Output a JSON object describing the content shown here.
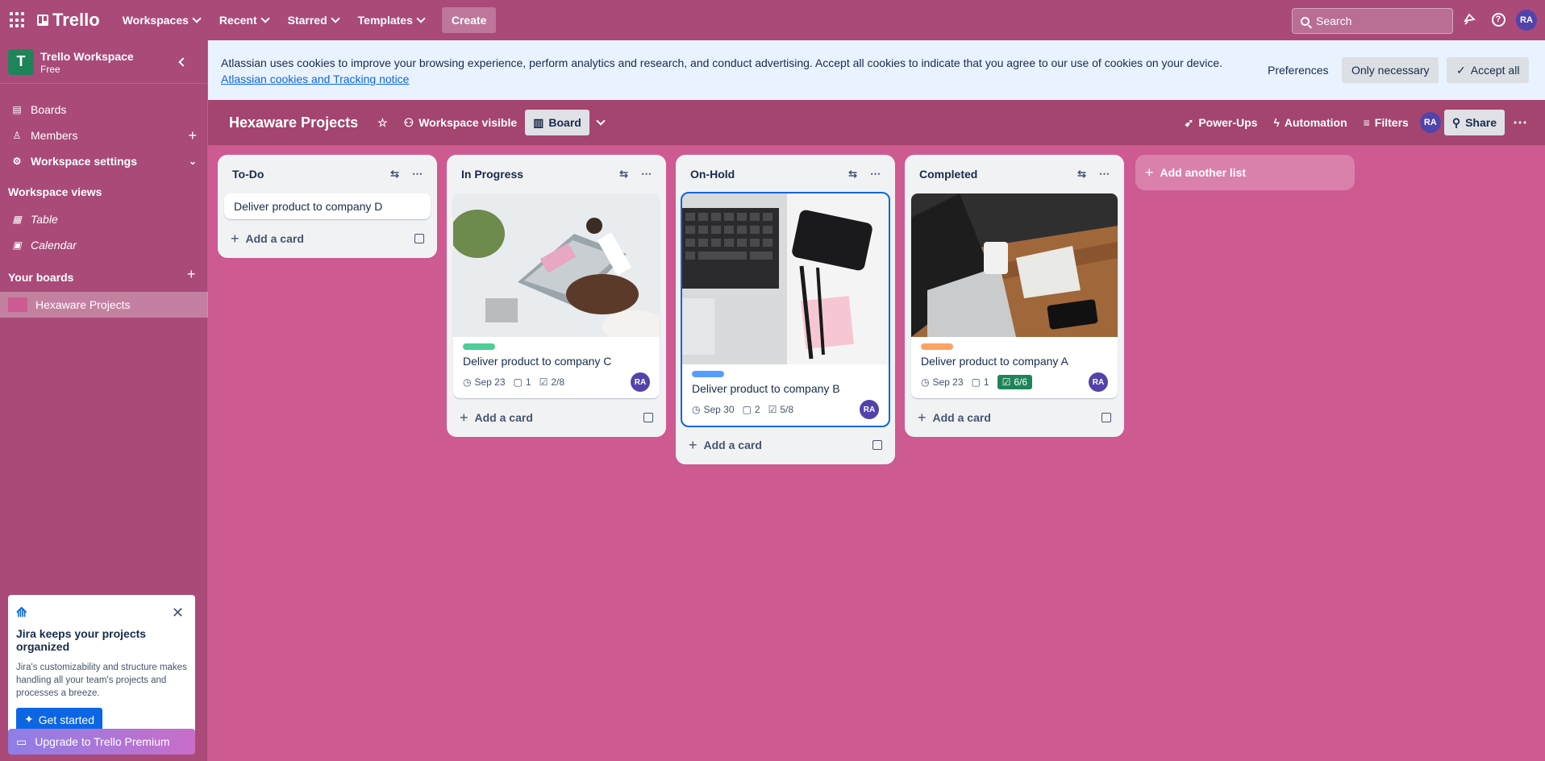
{
  "topnav": {
    "brand": "Trello",
    "menus": [
      "Workspaces",
      "Recent",
      "Starred",
      "Templates"
    ],
    "create_label": "Create",
    "search_placeholder": "Search",
    "user_initials": "RA"
  },
  "sidebar": {
    "workspace_initial": "T",
    "workspace_name": "Trello Workspace",
    "workspace_plan": "Free",
    "items": [
      {
        "label": "Boards"
      },
      {
        "label": "Members"
      },
      {
        "label": "Workspace settings"
      }
    ],
    "views_heading": "Workspace views",
    "views": [
      {
        "label": "Table"
      },
      {
        "label": "Calendar"
      }
    ],
    "boards_heading": "Your boards",
    "boards": [
      {
        "label": "Hexaware Projects"
      }
    ],
    "promo": {
      "title": "Jira keeps your projects organized",
      "body": "Jira's customizability and structure makes handling all your team's projects and processes a breeze.",
      "cta": "Get started"
    },
    "upgrade_label": "Upgrade to Trello Premium"
  },
  "cookie_banner": {
    "message": "Atlassian uses cookies to improve your browsing experience, perform analytics and research, and conduct advertising. Accept all cookies to indicate that you agree to our use of cookies on your device.",
    "link": "Atlassian cookies and Tracking notice",
    "preferences": "Preferences",
    "only_necessary": "Only necessary",
    "accept_all": "Accept all"
  },
  "board_header": {
    "title": "Hexaware Projects",
    "visibility": "Workspace visible",
    "view": "Board",
    "powerups": "Power-Ups",
    "automation": "Automation",
    "filters": "Filters",
    "member_initials": "RA",
    "share": "Share"
  },
  "lists": [
    {
      "title": "To-Do",
      "cards": [
        {
          "title": "Deliver product to company D"
        }
      ],
      "add_card": "Add a card"
    },
    {
      "title": "In Progress",
      "cards": [
        {
          "title": "Deliver product to company C",
          "label_color": "#4bce97",
          "due": "Sep 23",
          "comments": "1",
          "checklist": "2/8",
          "member": "RA"
        }
      ],
      "add_card": "Add a card"
    },
    {
      "title": "On-Hold",
      "cards": [
        {
          "title": "Deliver product to company B",
          "label_color": "#579dff",
          "due": "Sep 30",
          "comments": "2",
          "checklist": "5/8",
          "member": "RA"
        }
      ],
      "add_card": "Add a card"
    },
    {
      "title": "Completed",
      "cards": [
        {
          "title": "Deliver product to company A",
          "label_color": "#fea362",
          "due": "Sep 23",
          "comments": "1",
          "checklist": "6/6",
          "member": "RA"
        }
      ],
      "add_card": "Add a card"
    }
  ],
  "add_list_label": "Add another list",
  "colors": {
    "board_bg": "#cd5a91",
    "nav_bg": "#a94a79",
    "accent": "#0c66e4"
  }
}
